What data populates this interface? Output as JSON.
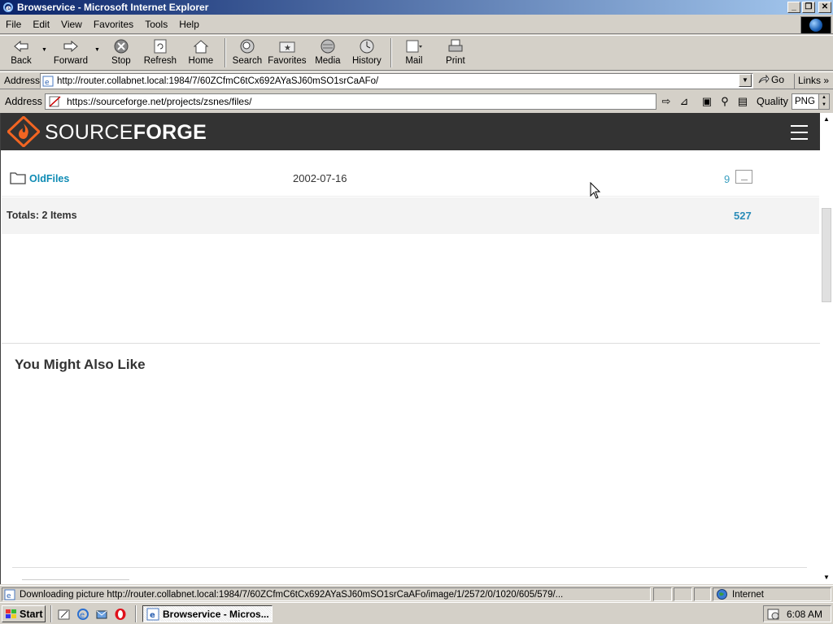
{
  "window": {
    "title": "Browservice - Microsoft Internet Explorer",
    "minimize": "0",
    "maximize": "1",
    "close": "r"
  },
  "menu": {
    "file": "File",
    "edit": "Edit",
    "view": "View",
    "favorites": "Favorites",
    "tools": "Tools",
    "help": "Help"
  },
  "toolbar": {
    "back": "Back",
    "forward": "Forward",
    "stop": "Stop",
    "refresh": "Refresh",
    "home": "Home",
    "search": "Search",
    "favorites": "Favorites",
    "media": "Media",
    "history": "History",
    "mail": "Mail",
    "print": "Print"
  },
  "addressbar": {
    "label": "Address",
    "url": "http://router.collabnet.local:1984/7/60ZCfmC6tCx692AYaSJ60mSO1srCaAFo/",
    "go": "Go",
    "links": "Links"
  },
  "inner_addressbar": {
    "label": "Address",
    "url": "https://sourceforge.net/projects/zsnes/files/",
    "quality_label": "Quality",
    "quality_value": "PNG"
  },
  "page": {
    "brand_thin": "SOURCE",
    "brand_bold": "FORGE",
    "file_row": {
      "name": "OldFiles",
      "date": "2002-07-16",
      "count": "9"
    },
    "totals": {
      "label": "Totals: 2 Items",
      "value": "527"
    },
    "you_might_also_like": "You Might Also Like"
  },
  "statusbar": {
    "message": "Downloading picture http://router.collabnet.local:1984/7/60ZCfmC6tCx692AYaSJ60mSO1srCaAFo/image/1/2572/0/1020/605/579/...",
    "zone": "Internet"
  },
  "taskbar": {
    "start": "Start",
    "task": "Browservice - Micros...",
    "clock": "6:08 AM"
  }
}
